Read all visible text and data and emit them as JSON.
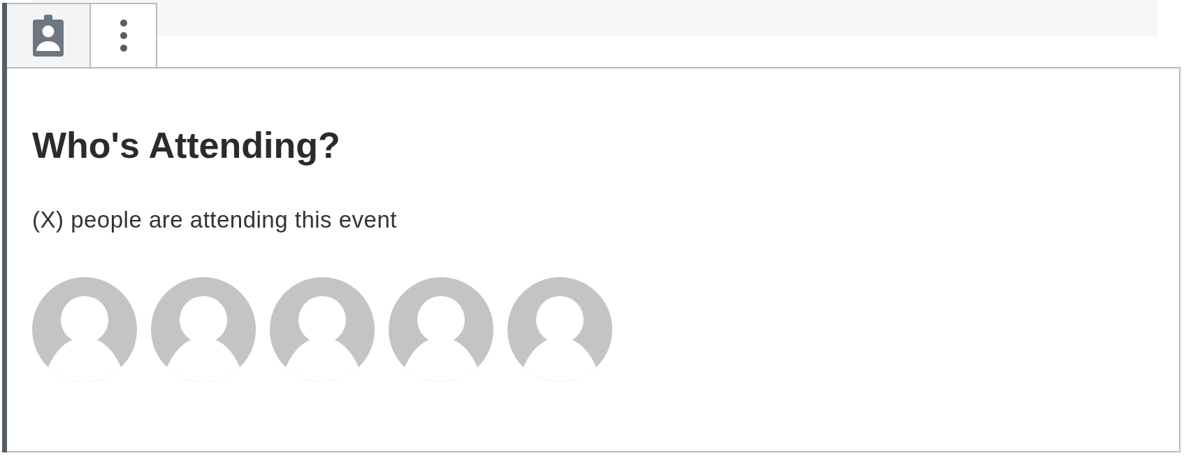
{
  "toolbar": [
    {
      "kind": "block-type"
    },
    {
      "kind": "more-options"
    }
  ],
  "block": {
    "heading": "Who's Attending?",
    "text": "(X) people are attending this event",
    "attendees": [
      {
        "kind": "silhouette"
      },
      {
        "kind": "silhouette"
      },
      {
        "kind": "silhouette"
      },
      {
        "kind": "silhouette"
      },
      {
        "kind": "silhouette"
      }
    ]
  }
}
